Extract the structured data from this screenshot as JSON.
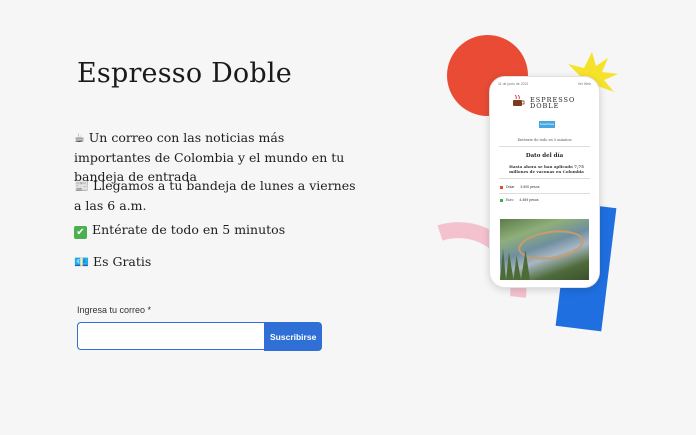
{
  "title": "Espresso Doble",
  "features": [
    {
      "icon": "☕",
      "icon_name": "coffee-icon",
      "text": "Un correo con las noticias más importantes de Colombia y el mundo en tu bandeja de entrada"
    },
    {
      "icon": "📰",
      "icon_name": "newspaper-icon",
      "text": "Llegamos a tu bandeja de lunes a viernes a las 6 a.m."
    },
    {
      "icon": "✔",
      "icon_name": "check-mark-icon",
      "text": "Entérate de todo en 5 minutos"
    },
    {
      "icon": "💶",
      "icon_name": "money-icon",
      "text": "Es Gratis"
    }
  ],
  "form": {
    "label": "Ingresa tu correo *",
    "email_value": "",
    "button_label": "Suscribirse"
  },
  "preview": {
    "status_left": "11 de junio de 2021",
    "status_right": "Ver Web",
    "logo_line1": "ESPRESSO",
    "logo_line2": "DOBLE",
    "button": "Suscríbete",
    "tagline": "Entérate de todo en 5 minutos",
    "section_title": "Dato del día",
    "headline": "Hasta ahora se han aplicado 7,75 millones de vacunas en Colombia",
    "rates": [
      {
        "label": "Dólar",
        "value": "3.900 pesos",
        "color": "#e94b35"
      },
      {
        "label": "Euro",
        "value": "4.459 pesos",
        "color": "#3cae4b"
      }
    ]
  },
  "colors": {
    "accent": "#2f6fd6",
    "red_circle": "#e94b35",
    "star": "#f7e22b",
    "blue_shape": "#1f6fe0",
    "pink_arc": "#f4c2cf"
  }
}
